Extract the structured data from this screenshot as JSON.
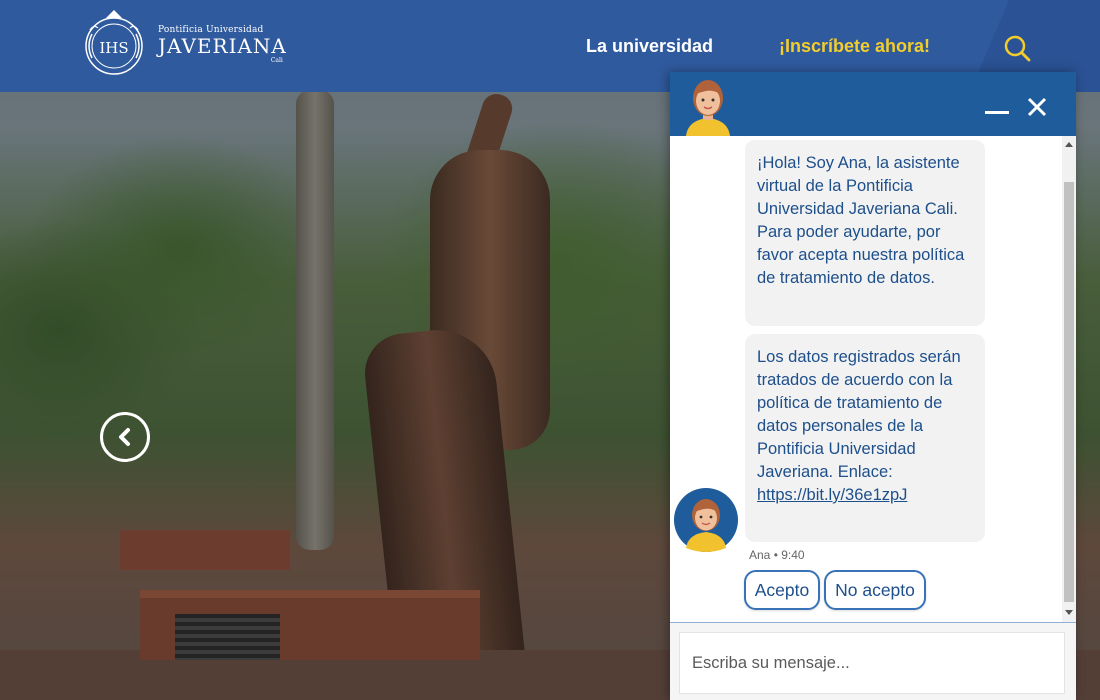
{
  "header": {
    "logo": {
      "line1": "Pontificia Universidad",
      "line2": "JAVERIANA",
      "line3": "Cali",
      "seal_text": "IHS"
    },
    "nav": [
      {
        "label": "La universidad",
        "color": "#ffffff"
      },
      {
        "label": "¡Inscríbete ahora!",
        "color": "#f3cd2c"
      }
    ],
    "search_icon": "search-icon",
    "bg_color": "#2f5a9e"
  },
  "hero": {
    "prev_icon": "chevron-left-icon"
  },
  "chat": {
    "header_color": "#1f5c9c",
    "minimize_icon": "minimize-icon",
    "close_icon": "close-icon",
    "messages": [
      {
        "text": "¡Hola! Soy Ana, la asistente virtual de la Pontificia Universidad Javeriana Cali. Para poder ayudarte, por favor acepta nuestra política de tratamiento de datos."
      },
      {
        "text": "Los datos registrados serán tratados de acuerdo con la política de tratamiento de datos personales de la Pontificia Universidad Javeriana. Enlace:",
        "link": "https://bit.ly/36e1zpJ"
      }
    ],
    "meta": {
      "sender": "Ana",
      "separator": "•",
      "time": "9:40"
    },
    "quick_replies": [
      {
        "label": "Acepto"
      },
      {
        "label": "No acepto"
      }
    ],
    "input": {
      "placeholder": "Escriba su mensaje...",
      "value": ""
    }
  }
}
